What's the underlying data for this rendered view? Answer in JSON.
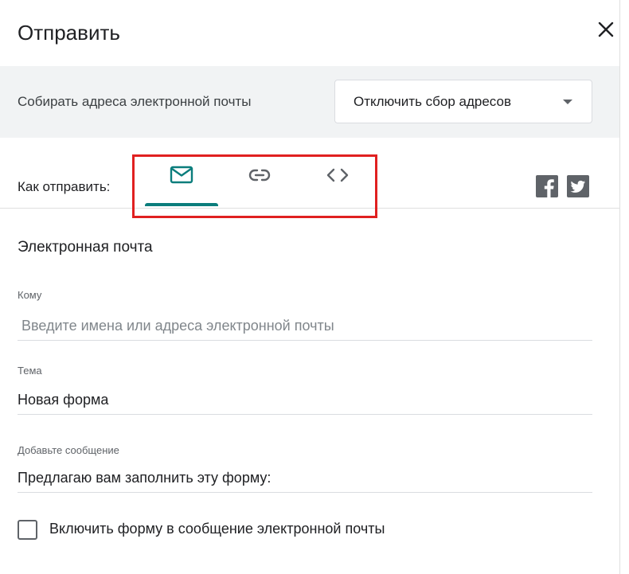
{
  "dialog": {
    "title": "Отправить"
  },
  "collect": {
    "label": "Собирать адреса электронной почты",
    "dropdown_value": "Отключить сбор адресов"
  },
  "send": {
    "label": "Как отправить:",
    "tabs": [
      {
        "icon": "mail-icon",
        "selected": true
      },
      {
        "icon": "link-icon",
        "selected": false
      },
      {
        "icon": "embed-code-icon",
        "selected": false
      }
    ],
    "social": [
      "facebook-icon",
      "twitter-icon"
    ]
  },
  "email": {
    "section_title": "Электронная почта",
    "to_label": "Кому",
    "to_placeholder": "Введите имена или адреса электронной почты",
    "subject_label": "Тема",
    "subject_value": "Новая форма",
    "message_label": "Добавьте сообщение",
    "message_value": "Предлагаю вам заполнить эту форму:",
    "include_form_label": "Включить форму в сообщение электронной почты"
  },
  "colors": {
    "accent": "#0b7d7c",
    "highlight": "#e02020",
    "band": "#f1f3f4"
  }
}
